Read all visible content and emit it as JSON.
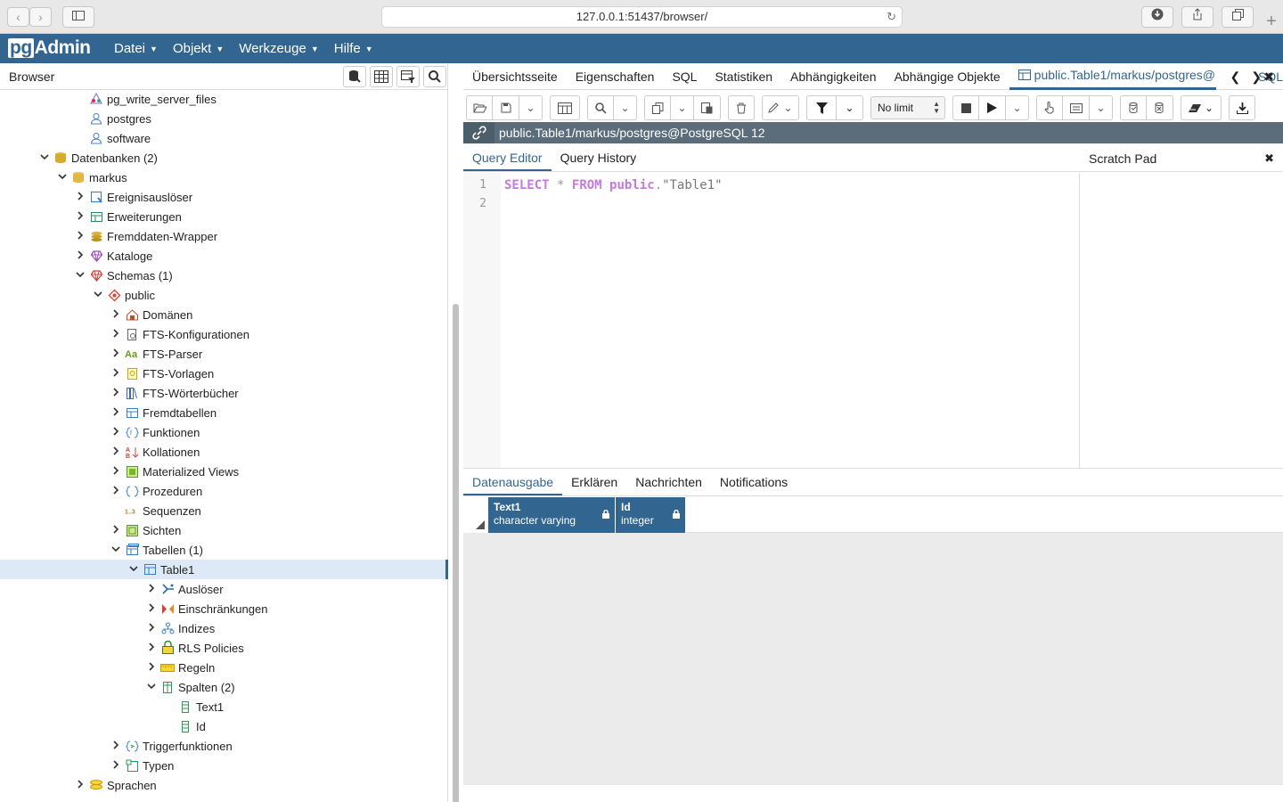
{
  "safari": {
    "url": "127.0.0.1:51437/browser/"
  },
  "app": {
    "logo_pg": "pg",
    "logo_admin": "Admin",
    "menu": [
      {
        "label": "Datei"
      },
      {
        "label": "Objekt"
      },
      {
        "label": "Werkzeuge"
      },
      {
        "label": "Hilfe"
      }
    ]
  },
  "browser": {
    "title": "Browser",
    "tree": [
      {
        "label": "pg_write_server_files",
        "level": 4,
        "toggle": "none",
        "icon": "role-group-icon"
      },
      {
        "label": "postgres",
        "level": 4,
        "toggle": "none",
        "icon": "user-icon"
      },
      {
        "label": "software",
        "level": 4,
        "toggle": "none",
        "icon": "user-icon"
      },
      {
        "label": "Datenbanken (2)",
        "level": 2,
        "toggle": "open",
        "icon": "databases-icon"
      },
      {
        "label": "markus",
        "level": 3,
        "toggle": "open",
        "icon": "database-icon"
      },
      {
        "label": "Ereignisauslöser",
        "level": 4,
        "toggle": "closed",
        "icon": "event-trigger-icon"
      },
      {
        "label": "Erweiterungen",
        "level": 4,
        "toggle": "closed",
        "icon": "extension-icon"
      },
      {
        "label": "Fremddaten-Wrapper",
        "level": 4,
        "toggle": "closed",
        "icon": "foreign-data-wrapper-icon"
      },
      {
        "label": "Kataloge",
        "level": 4,
        "toggle": "closed",
        "icon": "catalog-icon"
      },
      {
        "label": "Schemas (1)",
        "level": 4,
        "toggle": "open",
        "icon": "schemas-icon"
      },
      {
        "label": "public",
        "level": 5,
        "toggle": "open",
        "icon": "schema-icon"
      },
      {
        "label": "Domänen",
        "level": 6,
        "toggle": "closed",
        "icon": "domain-icon"
      },
      {
        "label": "FTS-Konfigurationen",
        "level": 6,
        "toggle": "closed",
        "icon": "fts-config-icon"
      },
      {
        "label": "FTS-Parser",
        "level": 6,
        "toggle": "closed",
        "icon": "fts-parser-icon"
      },
      {
        "label": "FTS-Vorlagen",
        "level": 6,
        "toggle": "closed",
        "icon": "fts-template-icon"
      },
      {
        "label": "FTS-Wörterbücher",
        "level": 6,
        "toggle": "closed",
        "icon": "fts-dictionary-icon"
      },
      {
        "label": "Fremdtabellen",
        "level": 6,
        "toggle": "closed",
        "icon": "foreign-table-icon"
      },
      {
        "label": "Funktionen",
        "level": 6,
        "toggle": "closed",
        "icon": "function-icon"
      },
      {
        "label": "Kollationen",
        "level": 6,
        "toggle": "closed",
        "icon": "collation-icon"
      },
      {
        "label": "Materialized Views",
        "level": 6,
        "toggle": "closed",
        "icon": "materialized-view-icon"
      },
      {
        "label": "Prozeduren",
        "level": 6,
        "toggle": "closed",
        "icon": "procedure-icon"
      },
      {
        "label": "Sequenzen",
        "level": 6,
        "toggle": "none",
        "icon": "sequence-icon"
      },
      {
        "label": "Sichten",
        "level": 6,
        "toggle": "closed",
        "icon": "view-icon"
      },
      {
        "label": "Tabellen (1)",
        "level": 6,
        "toggle": "open",
        "icon": "tables-icon"
      },
      {
        "label": "Table1",
        "level": 7,
        "toggle": "open",
        "icon": "table-icon",
        "selected": true
      },
      {
        "label": "Auslöser",
        "level": 8,
        "toggle": "closed",
        "icon": "trigger-icon"
      },
      {
        "label": "Einschränkungen",
        "level": 8,
        "toggle": "closed",
        "icon": "constraint-icon"
      },
      {
        "label": "Indizes",
        "level": 8,
        "toggle": "closed",
        "icon": "index-icon"
      },
      {
        "label": "RLS Policies",
        "level": 8,
        "toggle": "closed",
        "icon": "rls-policy-icon"
      },
      {
        "label": "Regeln",
        "level": 8,
        "toggle": "closed",
        "icon": "rule-icon"
      },
      {
        "label": "Spalten (2)",
        "level": 8,
        "toggle": "open",
        "icon": "columns-icon"
      },
      {
        "label": "Text1",
        "level": 9,
        "toggle": "none",
        "icon": "column-icon"
      },
      {
        "label": "Id",
        "level": 9,
        "toggle": "none",
        "icon": "column-icon"
      },
      {
        "label": "Triggerfunktionen",
        "level": 6,
        "toggle": "closed",
        "icon": "trigger-function-icon"
      },
      {
        "label": "Typen",
        "level": 6,
        "toggle": "closed",
        "icon": "type-icon"
      },
      {
        "label": "Sprachen",
        "level": 4,
        "toggle": "closed",
        "icon": "language-icon"
      }
    ]
  },
  "main_tabs": [
    {
      "label": "Übersichtsseite"
    },
    {
      "label": "Eigenschaften"
    },
    {
      "label": "SQL"
    },
    {
      "label": "Statistiken"
    },
    {
      "label": "Abhängigkeiten"
    },
    {
      "label": "Abhängige Objekte"
    },
    {
      "label": "public.Table1/markus/postgres@",
      "active": true
    }
  ],
  "tab_overflow_label": "SQL",
  "toolbar": {
    "limit": "No limit"
  },
  "connection": {
    "label": "public.Table1/markus/postgres@PostgreSQL 12"
  },
  "editor_tabs": [
    {
      "label": "Query Editor",
      "active": true
    },
    {
      "label": "Query History"
    }
  ],
  "editor": {
    "line_numbers": [
      "1",
      "2"
    ],
    "code": {
      "select": "SELECT",
      "star": "*",
      "from": "FROM",
      "schema": "public",
      "dot": ".",
      "table": "\"Table1\""
    }
  },
  "scratch_pad": {
    "title": "Scratch Pad"
  },
  "output_tabs": [
    {
      "label": "Datenausgabe",
      "active": true
    },
    {
      "label": "Erklären"
    },
    {
      "label": "Nachrichten"
    },
    {
      "label": "Notifications"
    }
  ],
  "grid": {
    "columns": [
      {
        "name": "Text1",
        "type": "character varying"
      },
      {
        "name": "Id",
        "type": "integer"
      }
    ]
  },
  "colors": {
    "brand": "#326690",
    "conn_bar": "#5b6d7b",
    "selected_row": "#dde9f7"
  }
}
